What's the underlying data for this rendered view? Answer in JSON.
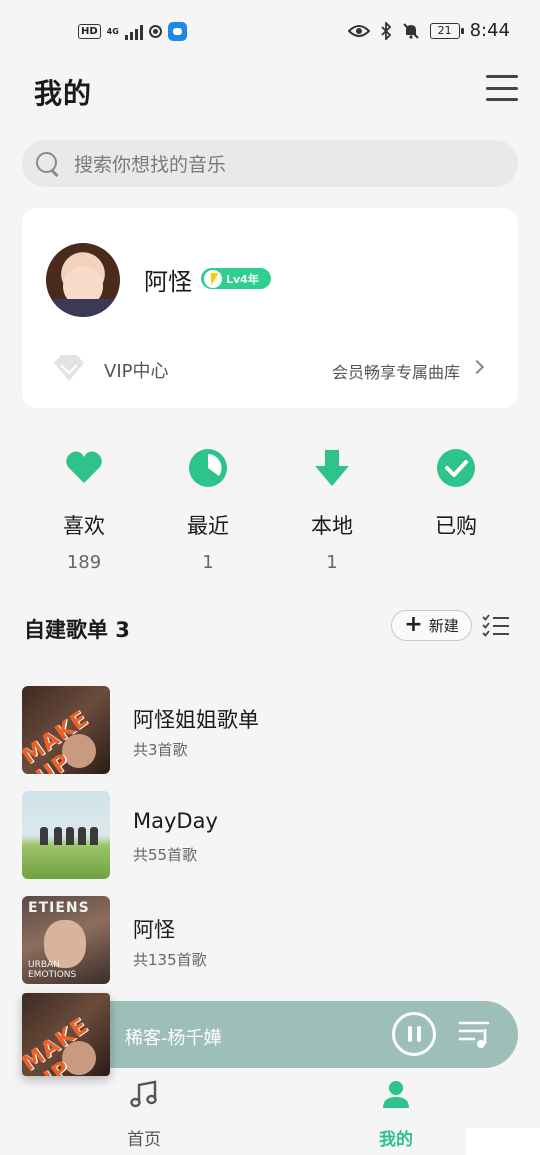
{
  "status_bar": {
    "network_badge": "HD",
    "network_type": "4G",
    "battery": "21",
    "time": "8:44"
  },
  "header": {
    "title": "我的"
  },
  "search": {
    "placeholder": "搜索你想找的音乐"
  },
  "profile": {
    "username": "阿怪",
    "level": "Lv4年",
    "vip_label": "VIP中心",
    "vip_subtitle": "会员畅享专属曲库"
  },
  "quick_actions": [
    {
      "label": "喜欢",
      "count": "189",
      "icon": "heart-icon"
    },
    {
      "label": "最近",
      "count": "1",
      "icon": "clock-icon"
    },
    {
      "label": "本地",
      "count": "1",
      "icon": "download-icon"
    },
    {
      "label": "已购",
      "count": "",
      "icon": "check-circle-icon"
    }
  ],
  "playlists_section": {
    "title": "自建歌单 3",
    "new_label": "新建",
    "items": [
      {
        "name": "阿怪姐姐歌单",
        "count": "共3首歌",
        "cover_text": "MAKE UP"
      },
      {
        "name": "MayDay",
        "count": "共55首歌"
      },
      {
        "name": "阿怪",
        "count": "共135首歌",
        "cover_top_text": "ETIENS",
        "cover_bottom_text": "URBAN EMOTIONS"
      }
    ]
  },
  "player": {
    "cover_text": "MAKE UP",
    "now_playing": "稀客-杨千嬅"
  },
  "bottom_nav": [
    {
      "label": "首页",
      "icon": "music-note-icon",
      "active": false
    },
    {
      "label": "我的",
      "icon": "person-icon",
      "active": true
    }
  ],
  "colors": {
    "accent": "#2dc38a",
    "player_bg": "#9ebfb9",
    "background": "#f5f5f5"
  }
}
